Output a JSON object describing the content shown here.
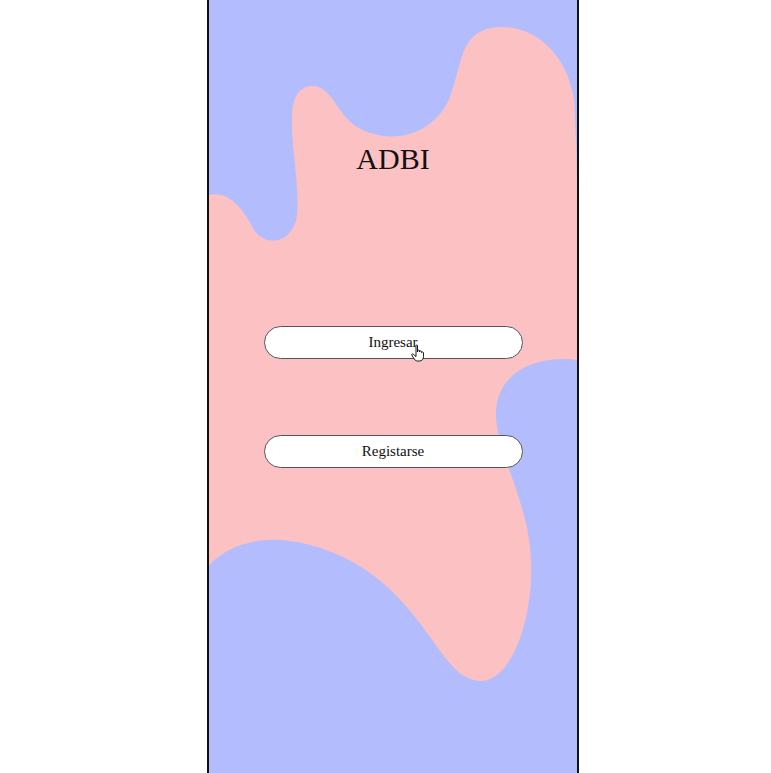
{
  "app": {
    "title": "ADBI"
  },
  "buttons": [
    {
      "label": "Ingresar",
      "hovered": true
    },
    {
      "label": "Registarse",
      "hovered": false
    }
  ]
}
